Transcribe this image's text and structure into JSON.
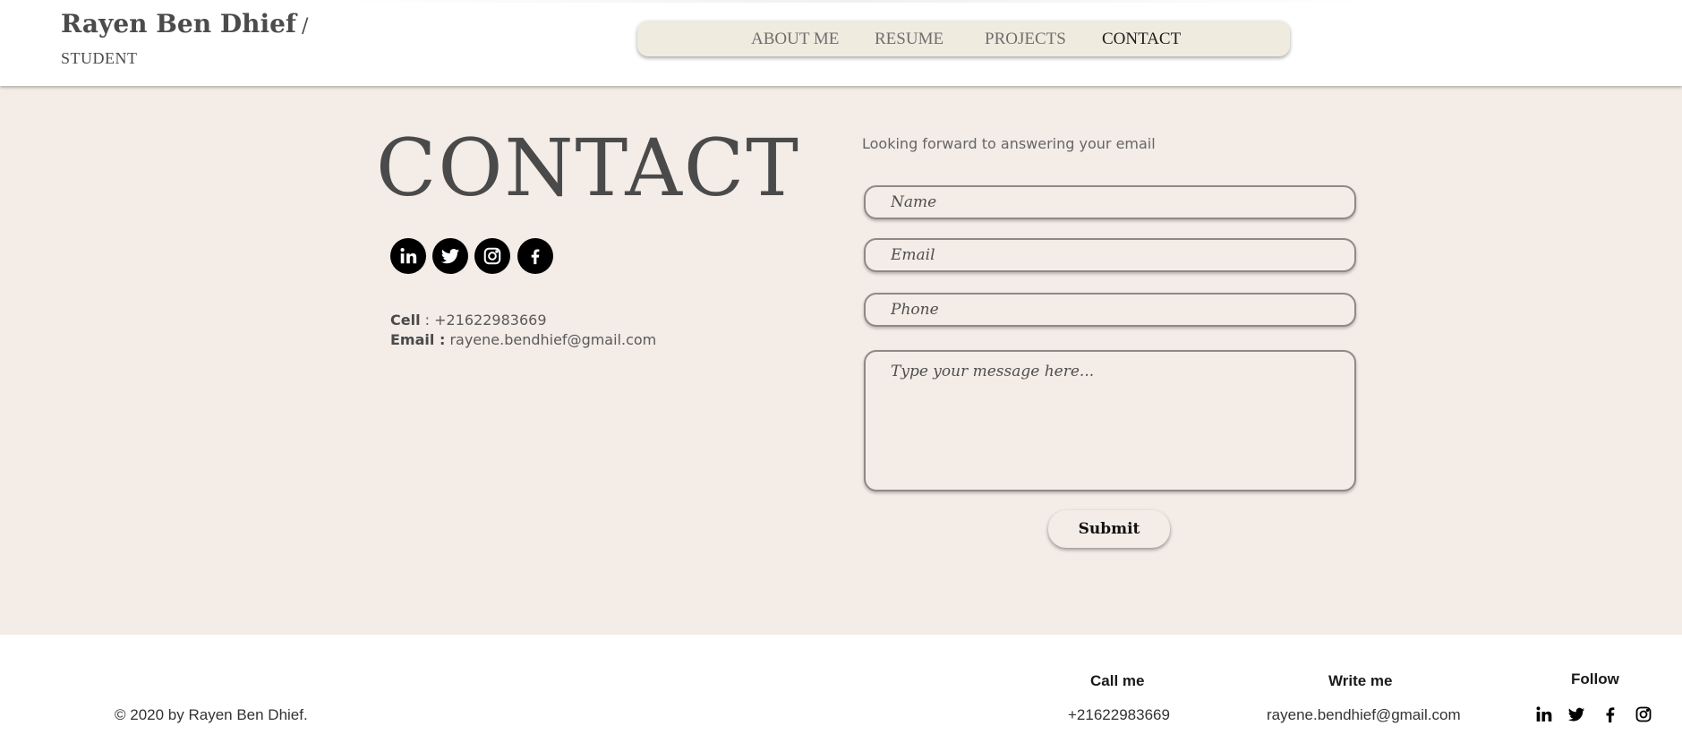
{
  "header": {
    "site_name": "Rayen Ben Dhief",
    "slash": "/",
    "role": "STUDENT"
  },
  "nav": {
    "items": [
      {
        "label": "ABOUT ME",
        "active": false
      },
      {
        "label": "RESUME",
        "active": false
      },
      {
        "label": "PROJECTS",
        "active": false
      },
      {
        "label": "CONTACT",
        "active": true
      }
    ]
  },
  "main": {
    "title": "CONTACT",
    "social_icons": [
      "linkedin-icon",
      "twitter-icon",
      "instagram-icon",
      "facebook-icon"
    ],
    "cell_label": "Cell",
    "cell_sep": " : ",
    "cell_value": "+21622983669",
    "email_label": "Email :",
    "email_value": "rayene.bendhief@gmail.com"
  },
  "form": {
    "intro": "Looking forward to answering your email",
    "name_placeholder": "Name",
    "email_placeholder": "Email",
    "phone_placeholder": "Phone",
    "message_placeholder": "Type your message here...",
    "submit_label": "Submit"
  },
  "footer": {
    "copyright": "© 2020 by Rayen Ben Dhief.",
    "call_heading": "Call me",
    "call_value": "+21622983669",
    "write_heading": "Write me",
    "write_value": "rayene.bendhief@gmail.com",
    "follow_heading": "Follow",
    "follow_icons": [
      "linkedin-icon",
      "twitter-icon",
      "facebook-icon",
      "instagram-icon"
    ]
  },
  "colors": {
    "page_bg": "#f3ece7",
    "nav_bg": "#f0ebdf",
    "text": "#4a4a4a"
  }
}
